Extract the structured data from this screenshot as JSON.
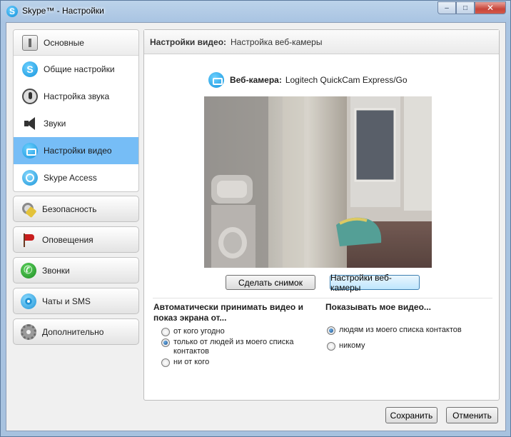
{
  "window": {
    "title": "Skype™ - Настройки",
    "controls": {
      "minimize": "–",
      "maximize": "□",
      "close": "✕"
    }
  },
  "sidebar": {
    "main_group": {
      "header": "Основные",
      "items": [
        {
          "label": "Общие настройки",
          "icon": "skype-icon"
        },
        {
          "label": "Настройка звука",
          "icon": "microphone-icon"
        },
        {
          "label": "Звуки",
          "icon": "speaker-icon"
        },
        {
          "label": "Настройки видео",
          "icon": "video-icon",
          "selected": true
        },
        {
          "label": "Skype Access",
          "icon": "skype-access-icon"
        }
      ]
    },
    "categories": [
      {
        "label": "Безопасность",
        "icon": "keys-icon"
      },
      {
        "label": "Оповещения",
        "icon": "flag-icon"
      },
      {
        "label": "Звонки",
        "icon": "phone-icon"
      },
      {
        "label": "Чаты и SMS",
        "icon": "chat-icon"
      },
      {
        "label": "Дополнительно",
        "icon": "gear-icon"
      }
    ]
  },
  "panel": {
    "header_bold": "Настройки видео:",
    "header_sub": "Настройка веб-камеры",
    "webcam_label": "Веб-камера:",
    "webcam_name": "Logitech QuickCam Express/Go",
    "snapshot_button": "Сделать снимок",
    "webcam_settings_button": "Настройки веб-камеры",
    "auto_accept": {
      "title_line1": "Автоматически принимать видео и",
      "title_line2": "показ экрана от...",
      "options": [
        {
          "line1": "от кого угодно",
          "line2": "",
          "checked": false
        },
        {
          "line1": "только от людей из моего списка",
          "line2": "контактов",
          "checked": true
        },
        {
          "line1": "ни от кого",
          "line2": "",
          "checked": false
        }
      ]
    },
    "show_video": {
      "title": "Показывать мое видео...",
      "options": [
        {
          "label": "людям из моего списка контактов",
          "checked": true
        },
        {
          "label": "никому",
          "checked": false
        }
      ]
    }
  },
  "footer": {
    "save": "Сохранить",
    "cancel": "Отменить"
  },
  "colors": {
    "selected_item": "#76bdf6",
    "skype_blue": "#1493dc",
    "window_frame": "#a9c4e2"
  }
}
